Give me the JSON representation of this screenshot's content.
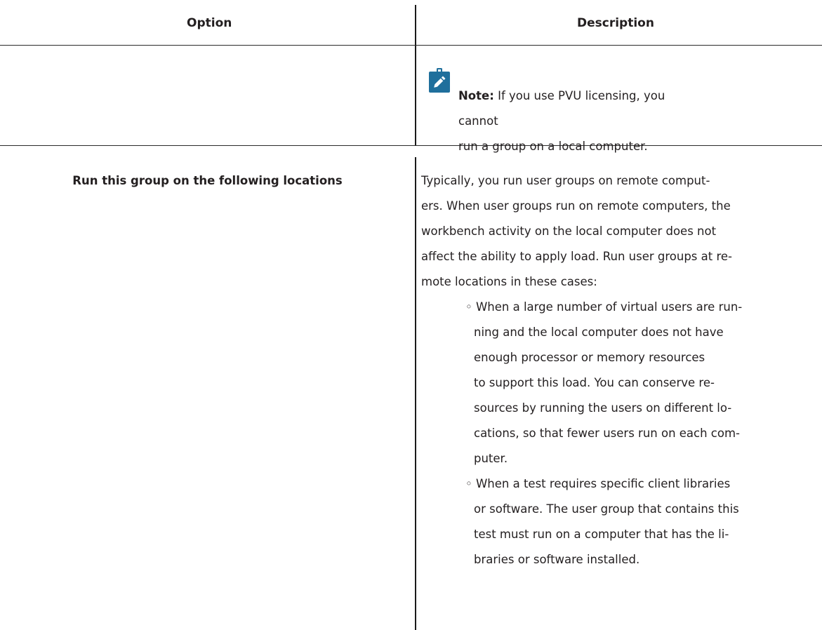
{
  "table": {
    "headers": {
      "option": "Option",
      "description": "Description"
    },
    "rows": [
      {
        "note": {
          "icon": "pencil-note-icon",
          "label": "Note:",
          "lines": [
            " If you use PVU licensing, you cannot",
            "run a group on a local computer."
          ]
        }
      },
      {
        "option": "Run this group on the following locations",
        "description_lines": [
          "Typically, you run user groups on remote comput-",
          "ers. When user groups run on remote computers, the",
          "workbench activity on the local computer does not",
          "affect the ability to apply load. Run user groups at re-",
          "mote locations in these cases:"
        ],
        "bullets": [
          {
            "lines": [
              "When a large number of virtual users are run-",
              "ning and the local computer does not have",
              "enough processor or memory resources",
              "to support this load. You can conserve re-",
              "sources by running the users on different lo-",
              "cations, so that fewer users run on each com-",
              "puter."
            ]
          },
          {
            "lines": [
              "When a test requires specific client libraries",
              "or software. The user group that contains this",
              "test must run on a computer that has the li-",
              "braries or software installed."
            ]
          }
        ]
      }
    ]
  },
  "colors": {
    "note_icon_bg": "#1f6f9c",
    "text": "#231f20",
    "rule": "#2a2a2a"
  }
}
